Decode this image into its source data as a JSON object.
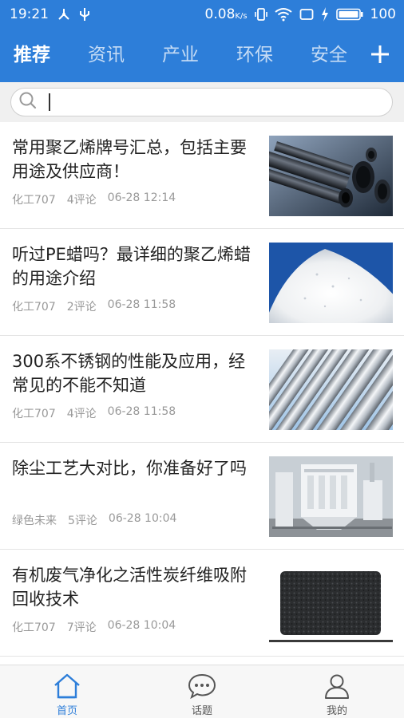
{
  "status": {
    "time": "19:21",
    "network_speed": "0.08",
    "network_unit": "K/s",
    "battery": "100"
  },
  "tabs": [
    "推荐",
    "资讯",
    "产业",
    "环保",
    "安全"
  ],
  "add_icon": "plus-icon",
  "search": {
    "placeholder": "",
    "icon": "search-icon"
  },
  "articles": [
    {
      "title": "常用聚乙烯牌号汇总，包括主要用途及供应商！",
      "source": "化工707",
      "comments": "4评论",
      "time": "06-28 12:14"
    },
    {
      "title": "听过PE蜡吗？最详细的聚乙烯蜡的用途介绍",
      "source": "化工707",
      "comments": "2评论",
      "time": "06-28 11:58"
    },
    {
      "title": "300系不锈钢的性能及应用，经常见的不能不知道",
      "source": "化工707",
      "comments": "4评论",
      "time": "06-28 11:58"
    },
    {
      "title": "除尘工艺大对比，你准备好了吗",
      "source": "绿色未来",
      "comments": "5评论",
      "time": "06-28 10:04"
    },
    {
      "title": "有机废气净化之活性炭纤维吸附回收技术",
      "source": "化工707",
      "comments": "7评论",
      "time": "06-28 10:04"
    }
  ],
  "bottom_nav": [
    {
      "label": "首页",
      "icon": "home-icon"
    },
    {
      "label": "话题",
      "icon": "chat-bubble-icon"
    },
    {
      "label": "我的",
      "icon": "user-icon"
    }
  ],
  "colors": {
    "primary": "#2d7ed9",
    "meta_text": "#999999"
  }
}
